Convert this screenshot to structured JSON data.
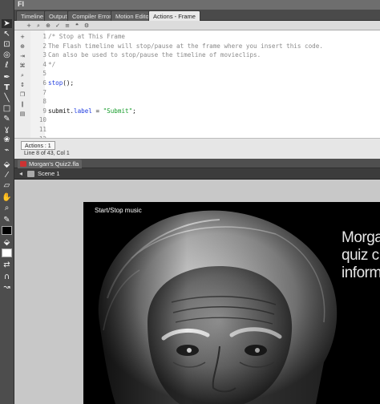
{
  "app": {
    "top_label": "Fl"
  },
  "panel_tabs": [
    "Timeline",
    "Output",
    "Compiler Errors",
    "Motion Editor",
    "Actions - Frame"
  ],
  "code": {
    "lines": [
      {
        "n": "1",
        "parts": [
          {
            "t": "/* Stop at This Frame",
            "c": "comment"
          }
        ]
      },
      {
        "n": "2",
        "parts": [
          {
            "t": "The Flash timeline will stop/pause at the frame where you insert this code.",
            "c": "comment"
          }
        ]
      },
      {
        "n": "3",
        "parts": [
          {
            "t": "Can also be used to stop/pause the timeline of movieclips.",
            "c": "comment"
          }
        ]
      },
      {
        "n": "4",
        "parts": [
          {
            "t": "*/",
            "c": "comment"
          }
        ]
      },
      {
        "n": "5",
        "parts": []
      },
      {
        "n": "6",
        "parts": [
          {
            "t": "stop",
            "c": "keyword"
          },
          {
            "t": "();",
            "c": "plain"
          }
        ]
      },
      {
        "n": "7",
        "parts": []
      },
      {
        "n": "8",
        "parts": []
      },
      {
        "n": "9",
        "parts": [
          {
            "t": "submit.",
            "c": "plain"
          },
          {
            "t": "label",
            "c": "keyword"
          },
          {
            "t": " = ",
            "c": "plain"
          },
          {
            "t": "\"Submit\"",
            "c": "str"
          },
          {
            "t": ";",
            "c": "plain"
          }
        ]
      },
      {
        "n": "10",
        "parts": []
      },
      {
        "n": "11",
        "parts": []
      },
      {
        "n": "12",
        "parts": []
      }
    ]
  },
  "actions_status": {
    "tab_label": "Actions : 1",
    "line_info": "Line 8 of 43, Col 1"
  },
  "document": {
    "tab_label": "Morgan's Quiz2.fla",
    "scene_label": "Scene 1"
  },
  "stage": {
    "music_label": "Start/Stop music",
    "title_lines": [
      "Morga",
      "quiz c",
      "inform"
    ]
  },
  "colors": {
    "code_keyword": "#1f3ce0",
    "code_comment": "#8a8a8a",
    "code_string": "#169c2a",
    "stage_bg": "#000000"
  }
}
